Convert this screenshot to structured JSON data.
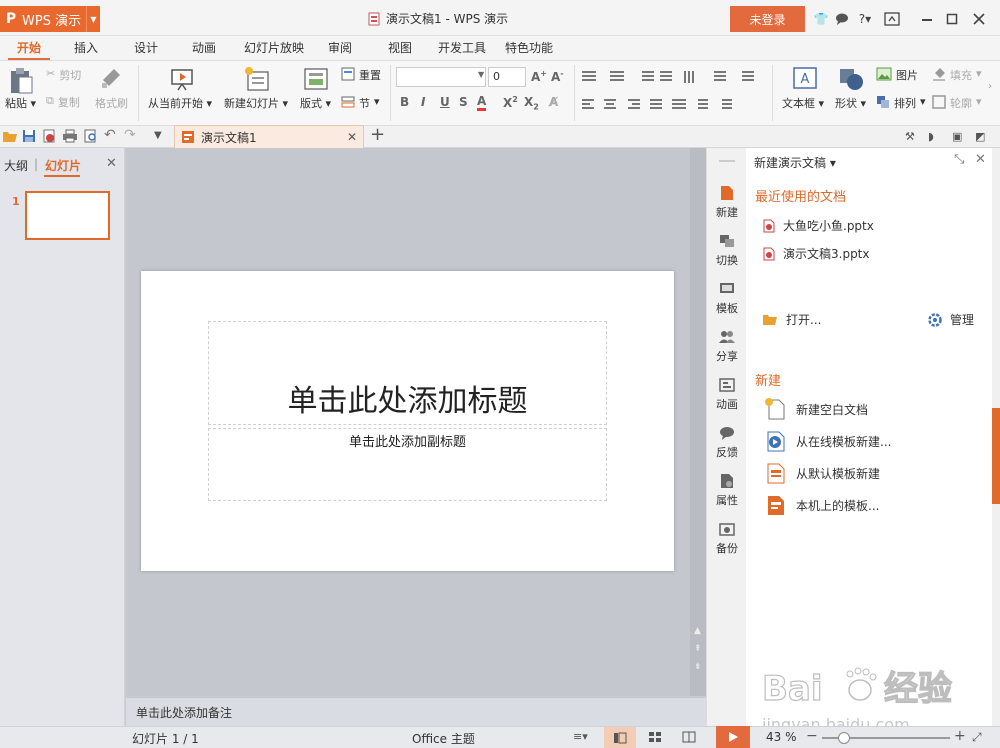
{
  "app": {
    "name": "WPS 演示",
    "doc_title": "演示文稿1 - WPS 演示",
    "login": "未登录"
  },
  "menu": {
    "tabs": [
      "开始",
      "插入",
      "设计",
      "动画",
      "幻灯片放映",
      "审阅",
      "视图",
      "开发工具",
      "特色功能"
    ]
  },
  "ribbon": {
    "paste": "粘贴",
    "cut": "剪切",
    "copy": "复制",
    "format_painter": "格式刷",
    "from_current": "从当前开始",
    "new_slide": "新建幻灯片",
    "layout": "版式",
    "reset": "重置",
    "section": "节",
    "font_size": "0",
    "textbox": "文本框",
    "shape": "形状",
    "picture": "图片",
    "arrange": "排列",
    "fill": "填充",
    "outline": "轮廓"
  },
  "doc_tab": {
    "label": "演示文稿1"
  },
  "left_panel": {
    "tab_outline": "大纲",
    "tab_slides": "幻灯片",
    "slide_number": "1"
  },
  "slide": {
    "title_placeholder": "单击此处添加标题",
    "subtitle_placeholder": "单击此处添加副标题"
  },
  "notes": {
    "placeholder": "单击此处添加备注"
  },
  "side_nav": {
    "items": [
      "新建",
      "切换",
      "模板",
      "分享",
      "动画",
      "反馈",
      "属性",
      "备份"
    ]
  },
  "task_pane": {
    "title": "新建演示文稿",
    "recent_header": "最近使用的文档",
    "recent": [
      "大鱼吃小鱼.pptx",
      "演示文稿3.pptx"
    ],
    "open": "打开...",
    "manage": "管理",
    "new_header": "新建",
    "new_items": [
      "新建空白文档",
      "从在线模板新建...",
      "从默认模板新建",
      "本机上的模板..."
    ]
  },
  "status": {
    "slide_info": "幻灯片 1 / 1",
    "theme": "Office 主题",
    "zoom": "43 %"
  },
  "colors": {
    "accent": "#e36a3c",
    "accent_text": "#e06a2a"
  },
  "watermark": {
    "brand": "Bai du 经验",
    "url": "jingyan.baidu.com"
  }
}
